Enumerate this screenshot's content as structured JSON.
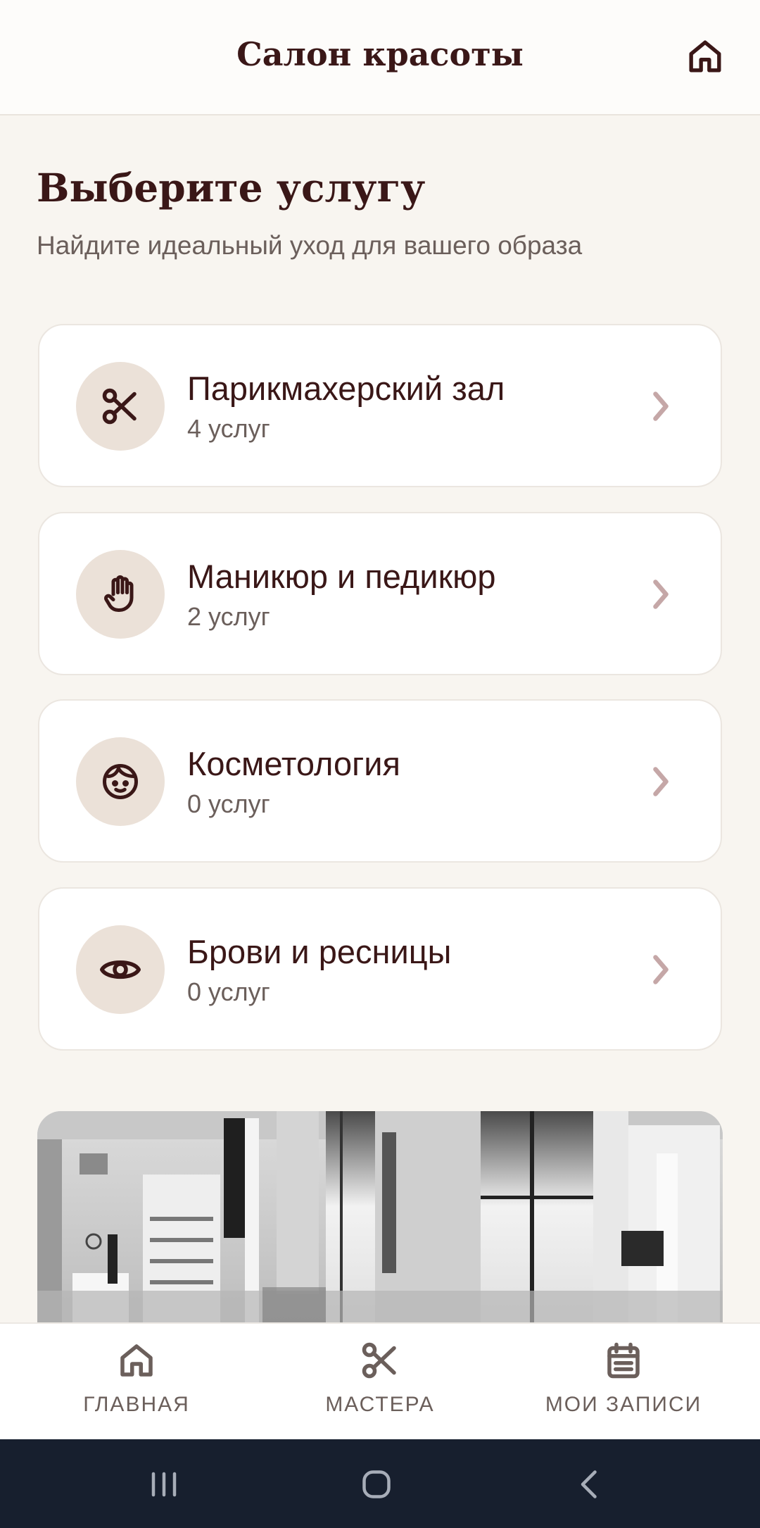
{
  "header": {
    "title": "Салон красоты",
    "home_icon": "home-icon"
  },
  "main": {
    "title": "Выберите услугу",
    "subtitle": "Найдите идеальный уход для вашего образа",
    "categories": [
      {
        "title": "Парикмахерский зал",
        "count": "4 услуг",
        "icon": "scissors-icon"
      },
      {
        "title": "Маникюр и педикюр",
        "count": "2 услуг",
        "icon": "hand-icon"
      },
      {
        "title": "Косметология",
        "count": "0 услуг",
        "icon": "face-icon"
      },
      {
        "title": "Брови и ресницы",
        "count": "0 услуг",
        "icon": "eye-icon"
      }
    ]
  },
  "bottom_nav": {
    "items": [
      {
        "label": "ГЛАВНАЯ",
        "icon": "home-icon"
      },
      {
        "label": "МАСТЕРА",
        "icon": "scissors-icon"
      },
      {
        "label": "МОИ ЗАПИСИ",
        "icon": "calendar-icon"
      }
    ]
  },
  "system_nav": {
    "buttons": [
      "recents-icon",
      "home-circle-icon",
      "back-icon"
    ]
  },
  "colors": {
    "primary": "#3a1717",
    "background": "#f8f5f0",
    "card": "#ffffff",
    "icon_circle": "#ebe1d8",
    "muted_text": "#6b5f5b",
    "chevron": "#c5a7a7",
    "nav_icon": "#6b5f5b",
    "system_bar": "#171f2e"
  }
}
